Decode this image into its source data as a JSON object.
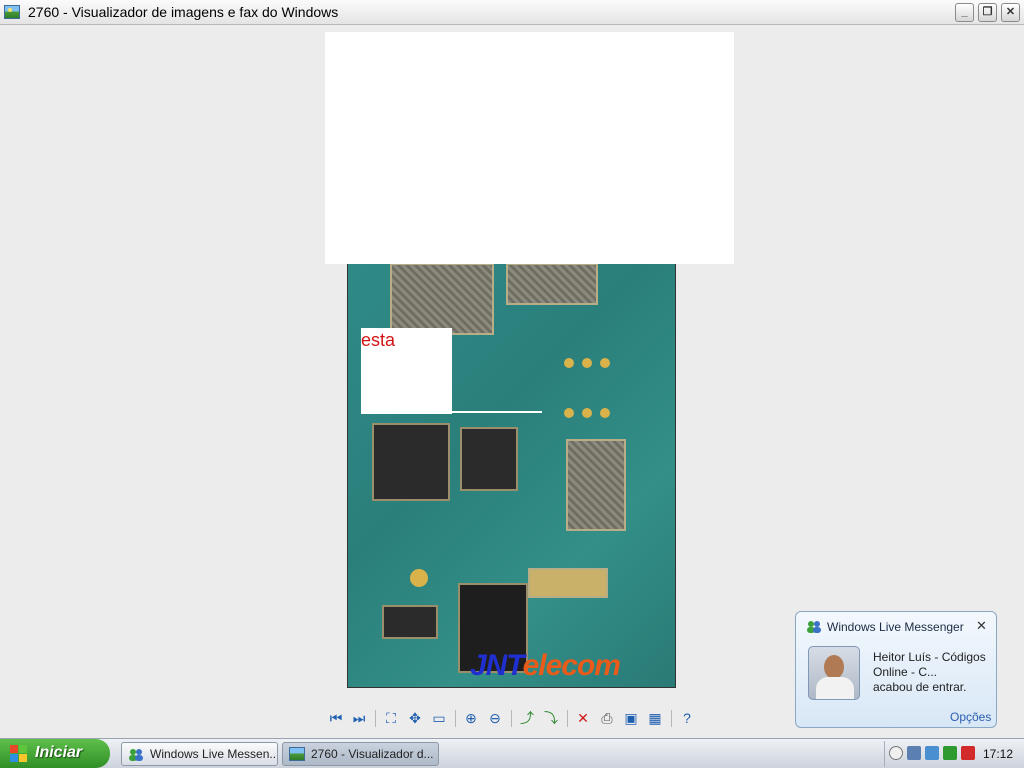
{
  "window": {
    "title": "2760 - Visualizador de imagens e fax do Windows",
    "minimize_icon": "minimize-icon",
    "maximize_icon": "restore-icon",
    "close_icon": "close-icon"
  },
  "image": {
    "note_text": "esta",
    "watermark_part1": "JNT",
    "watermark_part2": "elecom"
  },
  "toolbar": {
    "buttons": [
      "previous-image-icon",
      "next-image-icon",
      "best-fit-icon",
      "actual-size-icon",
      "slideshow-icon",
      "zoom-in-icon",
      "zoom-out-icon",
      "rotate-clockwise-icon",
      "rotate-counterclockwise-icon",
      "delete-icon",
      "print-icon",
      "save-icon",
      "open-editor-icon",
      "help-icon"
    ]
  },
  "taskbar": {
    "start_label": "Iniciar",
    "tasks": [
      {
        "label": "Windows Live Messen...",
        "active": false
      },
      {
        "label": "2760 - Visualizador d...",
        "active": true
      }
    ],
    "clock": "17:12"
  },
  "notification": {
    "title": "Windows Live Messenger",
    "message_line1": "Heitor Luís - Códigos Online - C...",
    "message_line2": "acabou de entrar.",
    "options_label": "Opções"
  }
}
